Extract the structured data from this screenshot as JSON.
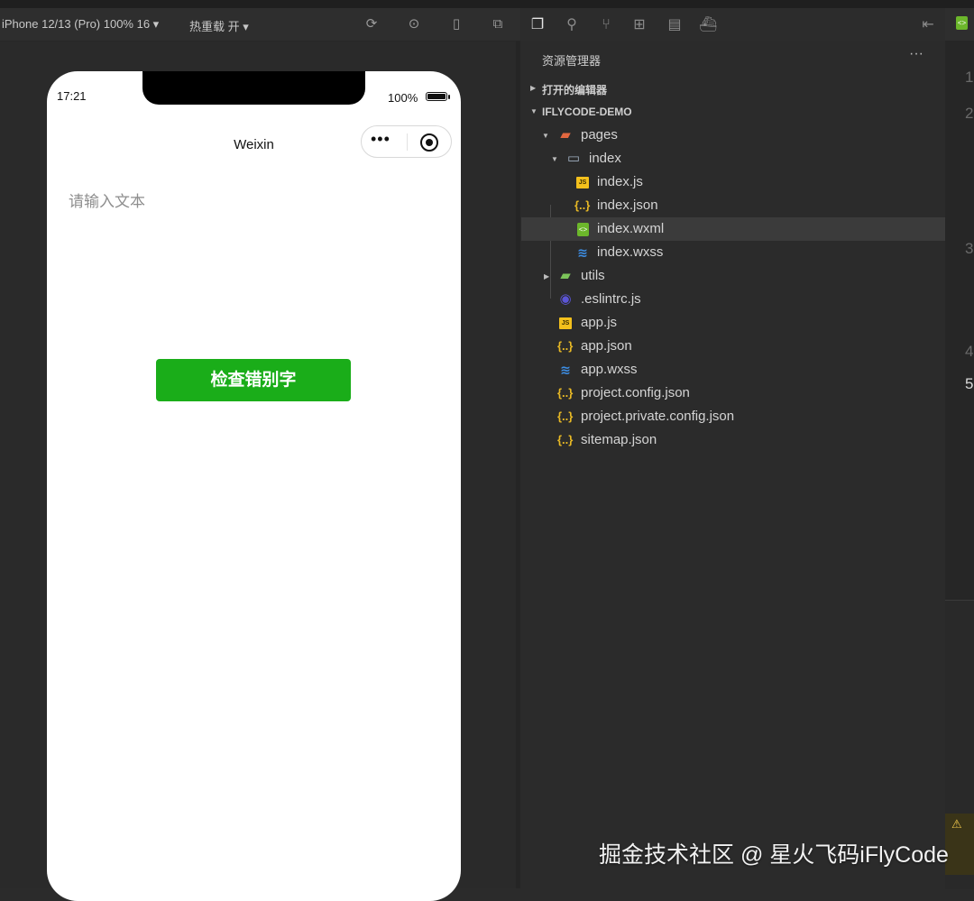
{
  "toolbar": {
    "device": "iPhone 12/13 (Pro) 100% 16 ▾",
    "hot_reload": "热重载 开 ▾",
    "icons": [
      "refresh-icon",
      "stop-icon",
      "phone-icon",
      "window-icon"
    ]
  },
  "activity_bar": {
    "icons": [
      "files-icon",
      "search-icon",
      "source-control-icon",
      "extensions-icon",
      "layout-icon",
      "docker-icon",
      "collapse-panel-icon"
    ]
  },
  "simulator": {
    "status_time": "17:21",
    "battery": "100%",
    "nav_title": "Weixin",
    "capsule_dots": "•••",
    "input_placeholder": "请输入文本",
    "button_label": "检查错别字"
  },
  "explorer": {
    "title": "资源管理器",
    "more": "···",
    "sections": [
      {
        "label": "打开的编辑器",
        "expanded": false
      },
      {
        "label": "IFLYCODE-DEMO",
        "expanded": true
      }
    ],
    "tree": [
      {
        "name": "pages",
        "type": "folder-pages",
        "twisty": "▾"
      },
      {
        "name": "index",
        "type": "folder-index",
        "twisty": "▾"
      },
      {
        "name": "index.js",
        "type": "js"
      },
      {
        "name": "index.json",
        "type": "json"
      },
      {
        "name": "index.wxml",
        "type": "wxml",
        "selected": true
      },
      {
        "name": "index.wxss",
        "type": "wxss"
      },
      {
        "name": "utils",
        "type": "folder-utils",
        "twisty": "▸"
      },
      {
        "name": ".eslintrc.js",
        "type": "eslint"
      },
      {
        "name": "app.js",
        "type": "js"
      },
      {
        "name": "app.json",
        "type": "json"
      },
      {
        "name": "app.wxss",
        "type": "wxss"
      },
      {
        "name": "project.config.json",
        "type": "json"
      },
      {
        "name": "project.private.config.json",
        "type": "json"
      },
      {
        "name": "sitemap.json",
        "type": "json"
      }
    ]
  },
  "editor": {
    "line_numbers": [
      "1",
      "2",
      "3",
      "4",
      "5"
    ]
  },
  "watermark": "掘金技术社区 @ 星火飞码iFlyCode",
  "colors": {
    "accent_green": "#1aad19",
    "js_icon": "#f3c01c",
    "wxss_icon": "#3d8fe6",
    "wxml_icon": "#6cb72b"
  }
}
